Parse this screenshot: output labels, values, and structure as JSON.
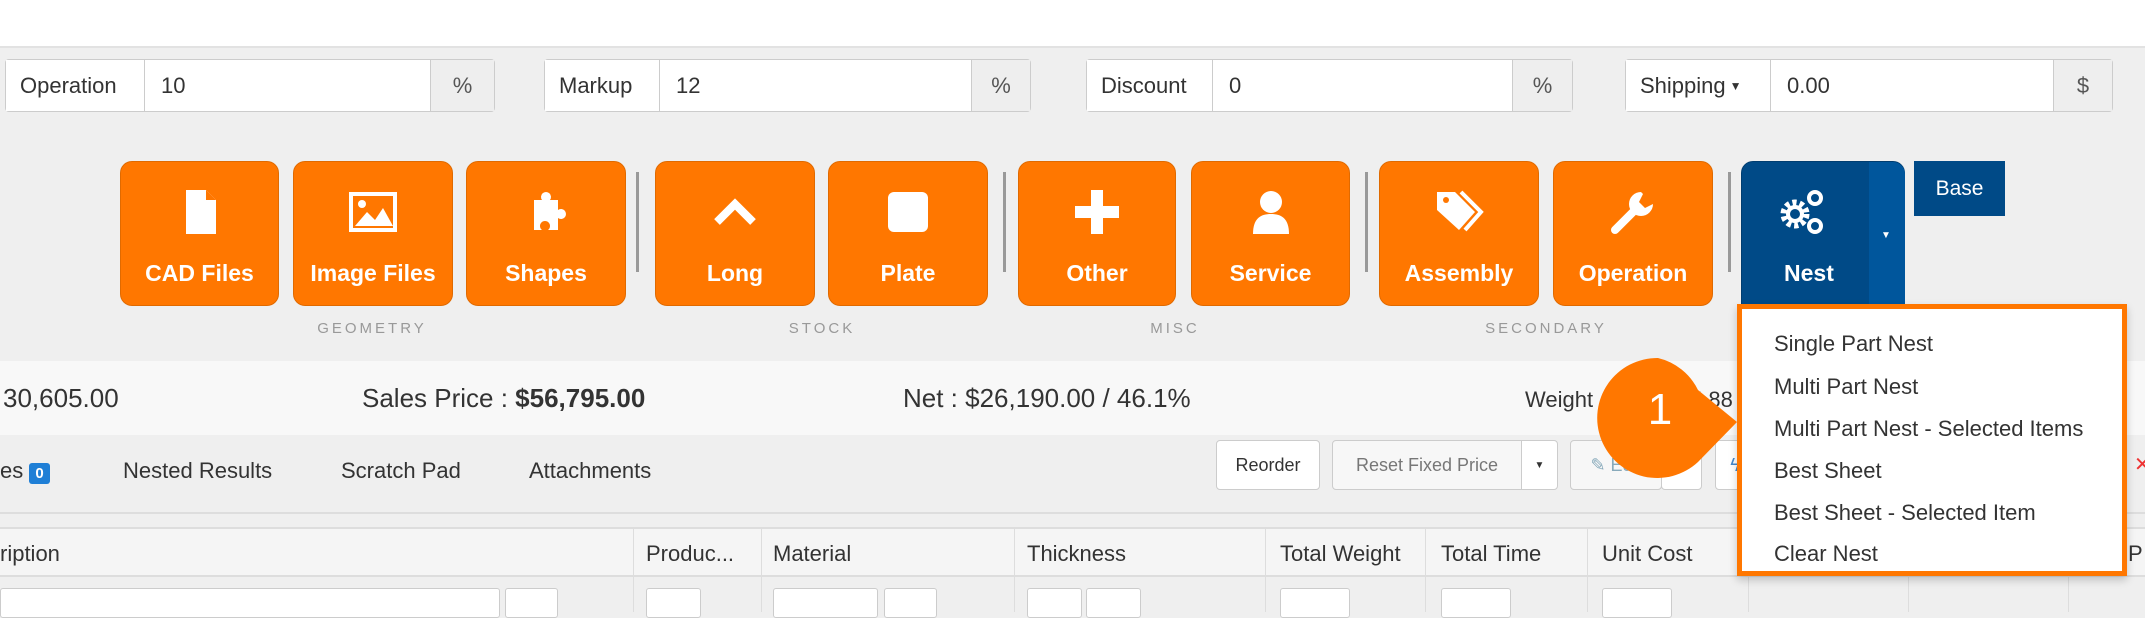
{
  "inputs": [
    {
      "label": "Operation",
      "value": "10",
      "addon": "%"
    },
    {
      "label": "Markup",
      "value": "12",
      "addon": "%"
    },
    {
      "label": "Discount",
      "value": "0",
      "addon": "%"
    },
    {
      "label": "Shipping",
      "value": "0.00",
      "addon": "$"
    }
  ],
  "buttons": [
    "CAD Files",
    "Image Files",
    "Shapes",
    "Long",
    "Plate",
    "Other",
    "Service",
    "Assembly",
    "Operation",
    "Nest"
  ],
  "base_label": "Base",
  "groups": [
    "GEOMETRY",
    "STOCK",
    "MISC",
    "SECONDARY"
  ],
  "summary": {
    "cost": "30,605.00",
    "sales_label": "Sales Price : ",
    "sales_value": "$56,795.00",
    "net": "Net : $26,190.00 / 46.1%",
    "weight_label": "Weight",
    "weight_value": "5.88 lb"
  },
  "tabs": {
    "first": "es",
    "badge": "0",
    "items": [
      "Nested Results",
      "Scratch Pad",
      "Attachments"
    ]
  },
  "toolbar": {
    "reorder": "Reorder",
    "reset": "Reset Fixed Price",
    "edit": "Edit"
  },
  "columns": [
    "ription",
    "Produc...",
    "Material",
    "Thickness",
    "Total Weight",
    "Total Time",
    "Unit Cost",
    "P"
  ],
  "menu": [
    "Single Part Nest",
    "Multi Part Nest",
    "Multi Part Nest - Selected Items",
    "Best Sheet",
    "Best Sheet - Selected Item",
    "Clear Nest"
  ],
  "callout": "1",
  "colors": {
    "orange": "#ff7700",
    "nest_blue": "#004a87",
    "badge_blue": "#1f7fd6"
  }
}
